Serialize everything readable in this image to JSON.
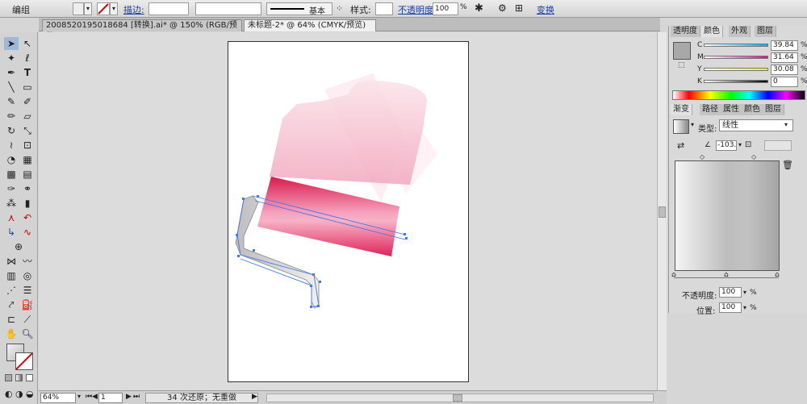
{
  "control_bar": {
    "mode_label": "编组",
    "stroke_label": "描边:",
    "style_name": "基本",
    "style_label": "样式:",
    "opacity_label": "不透明度:",
    "opacity_value": "100",
    "opacity_unit": "%",
    "transform_label": "变换"
  },
  "doc_tabs": [
    {
      "label": "20085201950186​84 [转换].ai* @ 150% (RGB/预览)",
      "active": false
    },
    {
      "label": "未标题-2* @ 64% (CMYK/预览)",
      "active": true
    }
  ],
  "color_panel": {
    "tabs": [
      "透明度",
      "颜色",
      "外观",
      "图层"
    ],
    "channels": [
      {
        "letter": "C",
        "value": "39.84"
      },
      {
        "letter": "M",
        "value": "31.64"
      },
      {
        "letter": "Y",
        "value": "30.08"
      },
      {
        "letter": "K",
        "value": "0"
      }
    ],
    "unit": "%"
  },
  "gradient_panel": {
    "tabs": [
      "渐变",
      "路径",
      "属性",
      "颜色",
      "图层"
    ],
    "type_label": "类型:",
    "type_value": "线性",
    "angle_value": "-103.",
    "opacity_label": "不透明度:",
    "opacity_value": "100",
    "location_label": "位置:",
    "location_value": "100",
    "unit": "%"
  },
  "status_bar": {
    "zoom": "64%",
    "page": "1",
    "message": "34 次还原；无重做"
  },
  "colors": {
    "accent_pink": "#e0335d",
    "light_pink": "#f6c4d2",
    "path_blue": "#4477ee"
  }
}
